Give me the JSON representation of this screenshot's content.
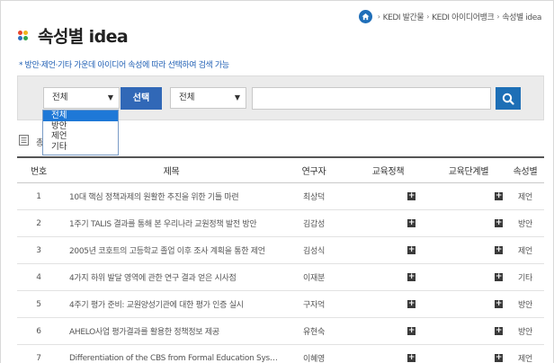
{
  "breadcrumb": {
    "items": [
      "KEDI 발간물",
      "KEDI 아이디어뱅크",
      "속성별 idea"
    ]
  },
  "title": "속성별 idea",
  "description": "* 방안·제언·기타 가운데 아이디어 속성에 따라 선택하여 검색 가능",
  "search": {
    "category_selected": "전체",
    "select_button": "선택",
    "field_selected": "전체",
    "keyword_value": "",
    "dropdown_options": [
      "전체",
      "방안",
      "제언",
      "기타"
    ]
  },
  "count_label": "총",
  "table": {
    "headers": [
      "번호",
      "제목",
      "연구자",
      "교육정책",
      "교육단계별",
      "속성별"
    ],
    "rows": [
      {
        "no": "1",
        "title": "10대 핵심 정책과제의 원활한 추진을 위한 기틀 마련",
        "author": "최상덕",
        "attr": "제언"
      },
      {
        "no": "2",
        "title": "1주기 TALIS 결과를 통해 본 우리나라 교원정책 발전 방안",
        "author": "김갑성",
        "attr": "방안"
      },
      {
        "no": "3",
        "title": "2005년 코호트의 고등학교 졸업 이후 조사 계획을 통한 제언",
        "author": "김성식",
        "attr": "제언"
      },
      {
        "no": "4",
        "title": "4가지 하위 발달 영역에 관한 연구 결과 얻은 시사점",
        "author": "이재분",
        "attr": "기타"
      },
      {
        "no": "5",
        "title": "4주기 평가 준비: 교원양성기관에 대한 평가 인증 실시",
        "author": "구자억",
        "attr": "방안"
      },
      {
        "no": "6",
        "title": "AHELO사업 평가결과를 활용한 정책정보 제공",
        "author": "유현숙",
        "attr": "방안"
      },
      {
        "no": "7",
        "title": "Differentiation of the CBS from Formal Education Sys…",
        "author": "이혜영",
        "attr": "제언"
      }
    ]
  },
  "colors": {
    "primary": "#3168b7",
    "search_btn": "#1d6fb6",
    "dropdown_highlight": "#1e78d7",
    "description": "#1f5fb4"
  }
}
